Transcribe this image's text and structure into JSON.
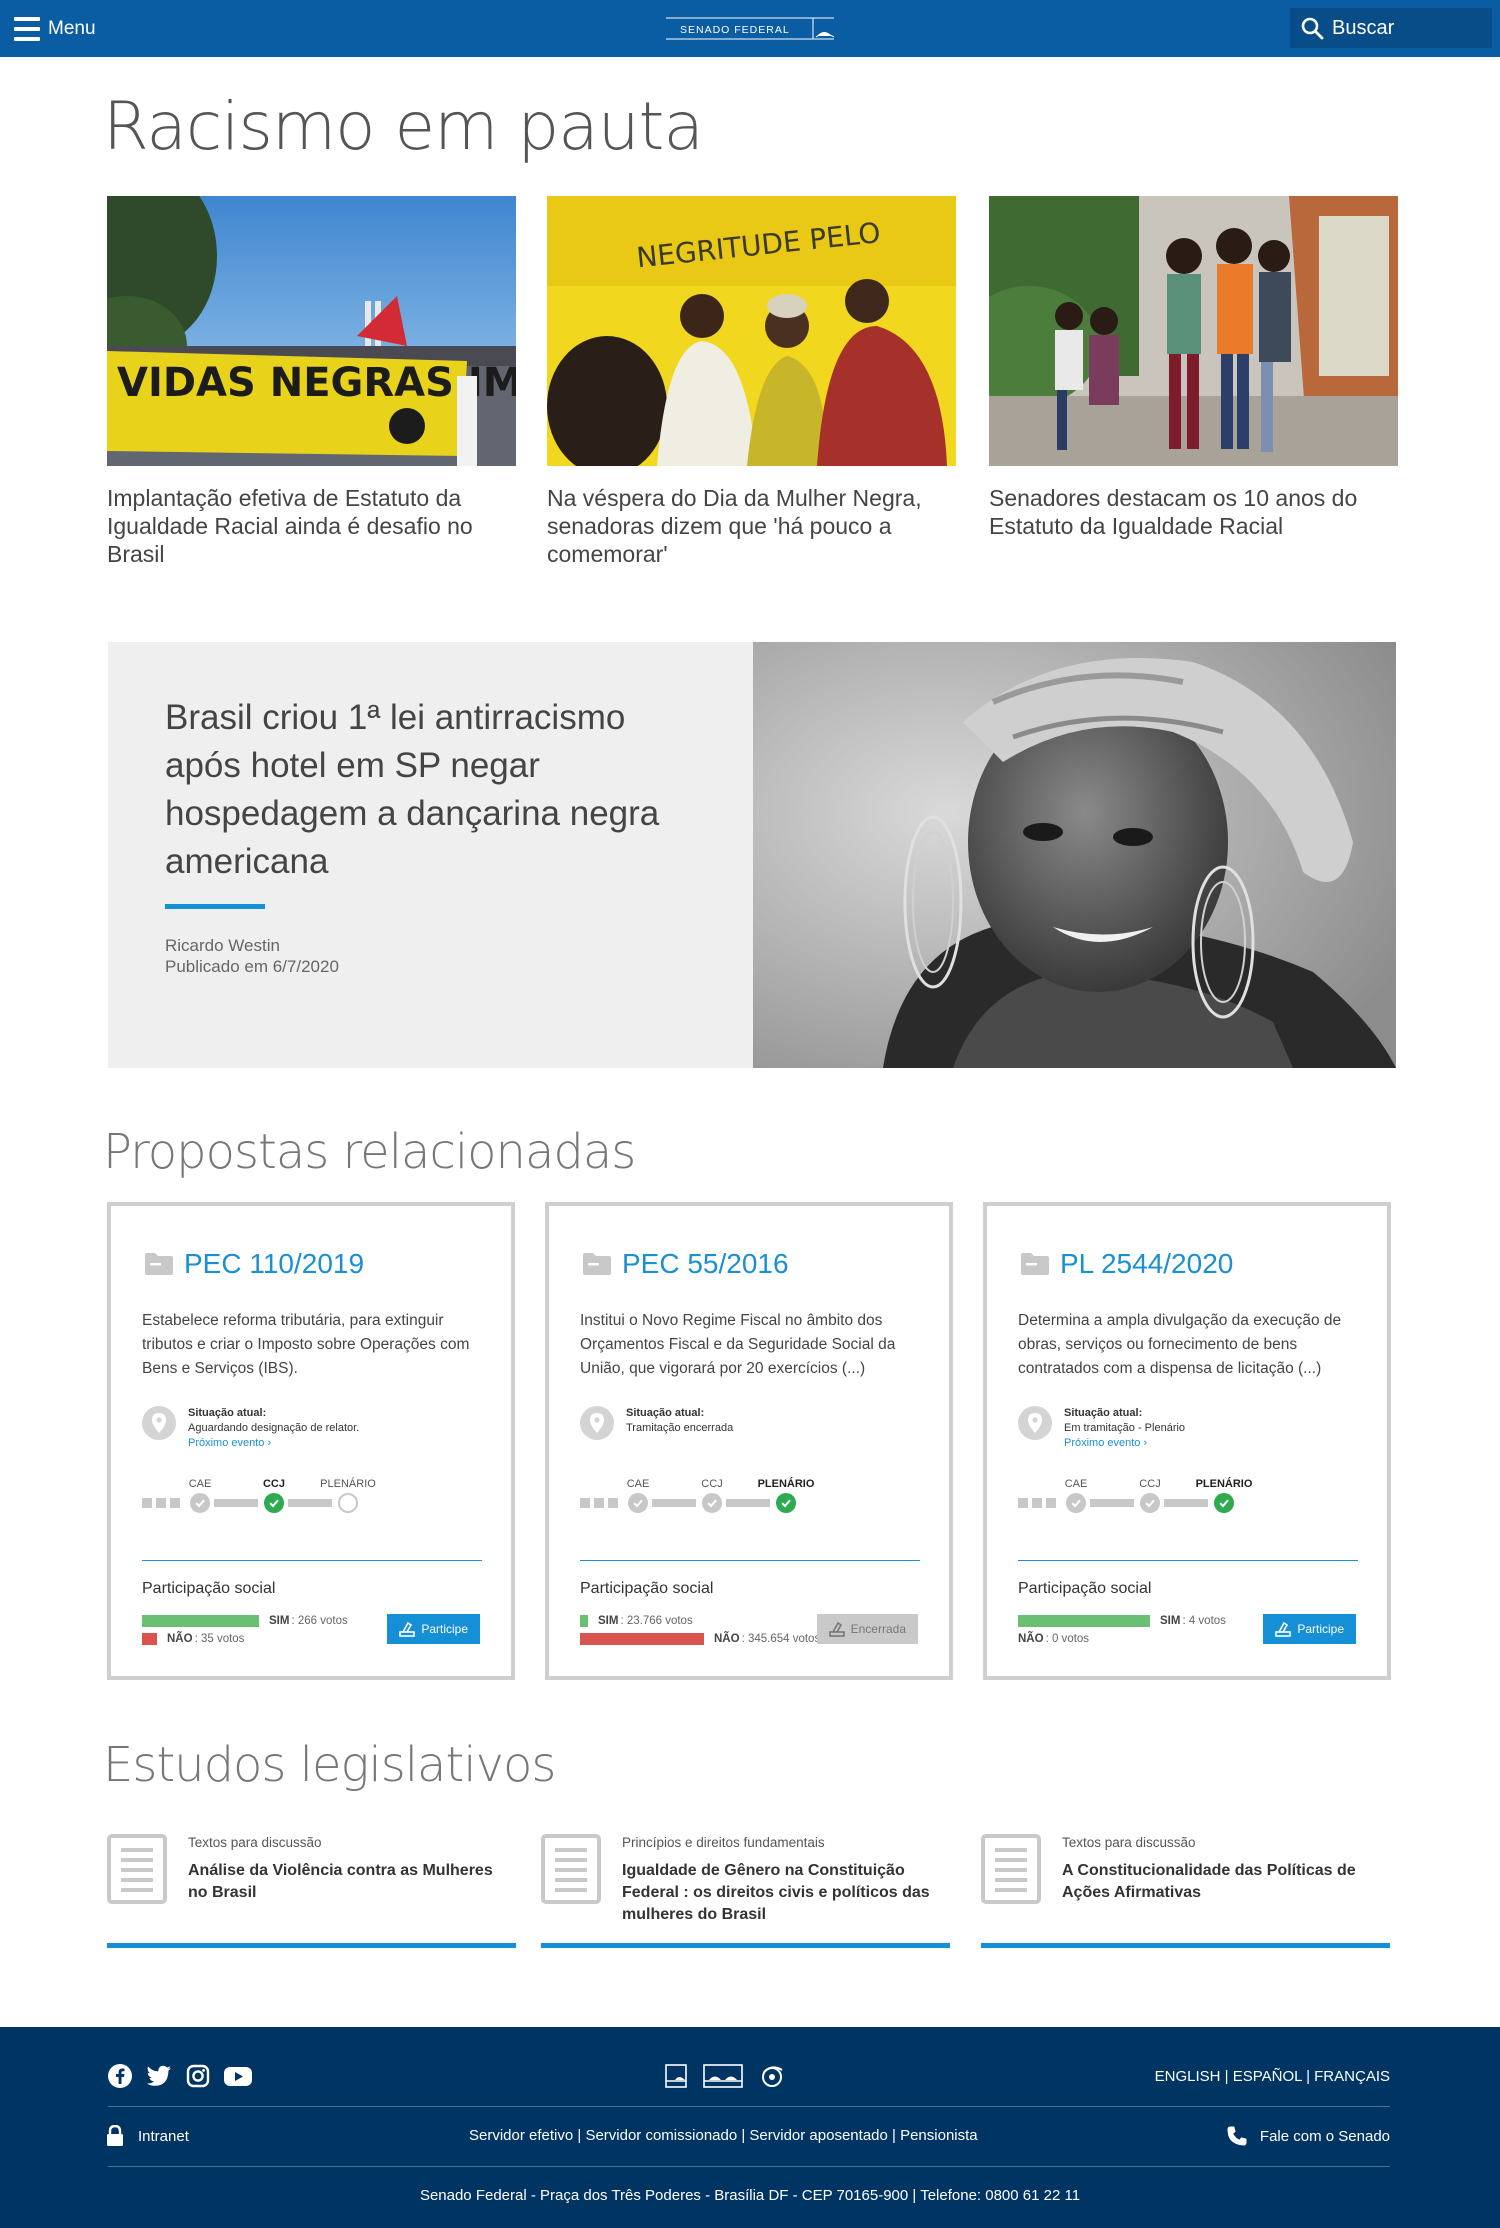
{
  "header": {
    "menu_label": "Menu",
    "logo_text": "SENADO FEDERAL",
    "search_placeholder": "Buscar"
  },
  "section_racismo": {
    "title": "Racismo em pauta",
    "news": [
      {
        "title": "Implantação efetiva de Estatuto da Igualdade Racial ainda é desafio no Brasil",
        "image_text": "VIDAS NEGRAS IMPORTAM"
      },
      {
        "title": "Na véspera do Dia da Mulher Negra, senadoras dizem que 'há pouco a comemorar'",
        "image_text": "NEGRITUDE PELO"
      },
      {
        "title": "Senadores destacam os 10 anos do Estatuto da Igualdade Racial"
      }
    ]
  },
  "feature": {
    "title": "Brasil criou 1ª lei antirracismo após hotel em SP negar hospedagem a dançarina negra americana",
    "author": "Ricardo Westin",
    "published": "Publicado em 6/7/2020",
    "accent_color": "#1590d7"
  },
  "propostas": {
    "title": "Propostas relacionadas",
    "cards": [
      {
        "code": "PEC 110/2019",
        "description": "Estabelece reforma tributária, para extinguir tributos e criar o Imposto sobre Operações com Bens e Serviços (IBS).",
        "situation_label": "Situação atual:",
        "situation": "Aguardando designação de relator.",
        "next_event": "Próximo evento ›",
        "steps": [
          {
            "label": "CAE",
            "state": "done"
          },
          {
            "label": "CCJ",
            "state": "current"
          },
          {
            "label": "PLENÁRIO",
            "state": "pending"
          }
        ],
        "participation_title": "Participação social",
        "yes_label": "SIM",
        "yes_votes": ": 266 votos",
        "yes_value": 266,
        "no_label": "NÃO",
        "no_votes": ": 35 votos",
        "no_value": 35,
        "button": "Participe",
        "button_enabled": true
      },
      {
        "code": "PEC 55/2016",
        "description": "Institui o Novo Regime Fiscal no âmbito dos Orçamentos Fiscal e da Seguridade Social da União,  que vigorará por 20 exercícios (...)",
        "situation_label": "Situação atual:",
        "situation": "Tramitação encerrada",
        "next_event": "",
        "steps": [
          {
            "label": "CAE",
            "state": "done"
          },
          {
            "label": "CCJ",
            "state": "done"
          },
          {
            "label": "PLENÁRIO",
            "state": "current"
          }
        ],
        "participation_title": "Participação social",
        "yes_label": "SIM",
        "yes_votes": ": 23.766 votos",
        "yes_value": 23766,
        "no_label": "NÃO",
        "no_votes": ": 345.654 votos",
        "no_value": 345654,
        "button": "Encerrada",
        "button_enabled": false
      },
      {
        "code": "PL 2544/2020",
        "description": "Determina a ampla divulgação da execução de obras, serviços ou fornecimento de bens contratados com a dispensa de licitação (...)",
        "situation_label": "Situação atual:",
        "situation": "Em tramitação - Plenário",
        "next_event": "Próximo evento ›",
        "steps": [
          {
            "label": "CAE",
            "state": "done"
          },
          {
            "label": "CCJ",
            "state": "done"
          },
          {
            "label": "PLENÁRIO",
            "state": "current"
          }
        ],
        "participation_title": "Participação social",
        "yes_label": "SIM",
        "yes_votes": ": 4 votos",
        "yes_value": 4,
        "no_label": "NÃO",
        "no_votes": ": 0 votos",
        "no_value": 0,
        "button": "Participe",
        "button_enabled": true
      }
    ]
  },
  "estudos": {
    "title": "Estudos legislativos",
    "items": [
      {
        "category": "Textos para discussão",
        "title": "Análise da Violência contra as Mulheres no Brasil"
      },
      {
        "category": "Princípios e direitos fundamentais",
        "title": "Igualdade de Gênero na Constituição Federal : os direitos civis e políticos das mulheres do Brasil"
      },
      {
        "category": "Textos para discussão",
        "title": "A Constitucionalidade das Políticas de Ações Afirmativas"
      }
    ]
  },
  "footer": {
    "social": [
      "facebook-icon",
      "twitter-icon",
      "instagram-icon",
      "youtube-icon"
    ],
    "languages": "ENGLISH | ESPAÑOL | FRANÇAIS",
    "intranet": "Intranet",
    "links": "Servidor efetivo | Servidor comissionado | Servidor aposentado | Pensionista",
    "contact": "Fale com o Senado",
    "address": "Senado Federal - Praça dos Três Poderes - Brasília DF - CEP 70165-900 | Telefone: 0800 61 22 11"
  }
}
